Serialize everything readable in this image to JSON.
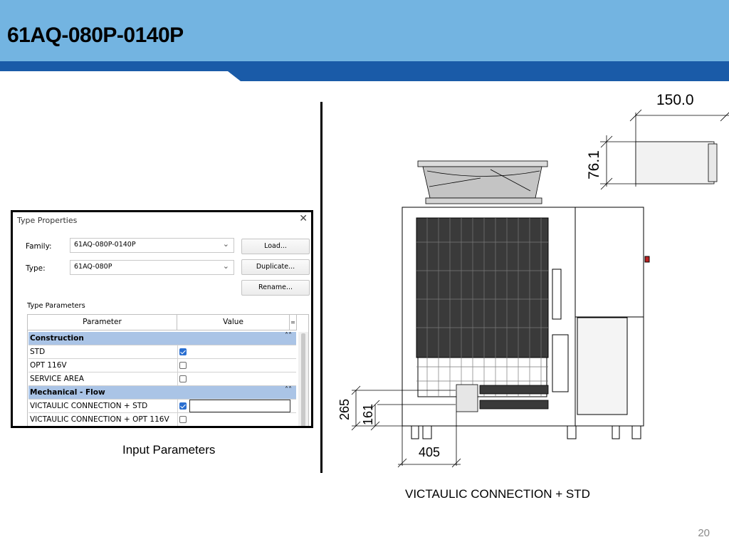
{
  "header": {
    "title": "61AQ-080P-0140P"
  },
  "dialog": {
    "title": "Type Properties",
    "family_label": "Family:",
    "family_value": "61AQ-080P-0140P",
    "type_label": "Type:",
    "type_value": "61AQ-080P",
    "buttons": {
      "load": "Load...",
      "duplicate": "Duplicate...",
      "rename": "Rename..."
    },
    "group_label": "Type Parameters",
    "columns": {
      "parameter": "Parameter",
      "value": "Value"
    },
    "rows": [
      {
        "kind": "group",
        "label": "Construction"
      },
      {
        "kind": "param",
        "label": "STD",
        "checked": true
      },
      {
        "kind": "param",
        "label": "OPT 116V",
        "checked": false
      },
      {
        "kind": "param",
        "label": "SERVICE AREA",
        "checked": false
      },
      {
        "kind": "group",
        "label": "Mechanical - Flow"
      },
      {
        "kind": "param",
        "label": "VICTAULIC CONNECTION + STD",
        "checked": true,
        "selected": true
      },
      {
        "kind": "param",
        "label": "VICTAULIC CONNECTION + OPT 116V",
        "checked": false
      }
    ]
  },
  "captions": {
    "left": "Input Parameters",
    "right": "VICTAULIC CONNECTION + STD"
  },
  "drawing": {
    "dim_width": "150.0",
    "dim_height": "76.1",
    "dim_265": "265",
    "dim_161": "161",
    "dim_405": "405"
  },
  "page_number": "20",
  "colors": {
    "header_bg": "#73b4e1",
    "header_band": "#1a5ba8",
    "group_row": "#aac4e6",
    "checkbox": "#2a6fd1"
  },
  "icons": {
    "close": "close-icon",
    "dropdown": "chevron-down-icon",
    "collapse": "collapse-up-icon",
    "checkbox": "checkbox-icon"
  }
}
